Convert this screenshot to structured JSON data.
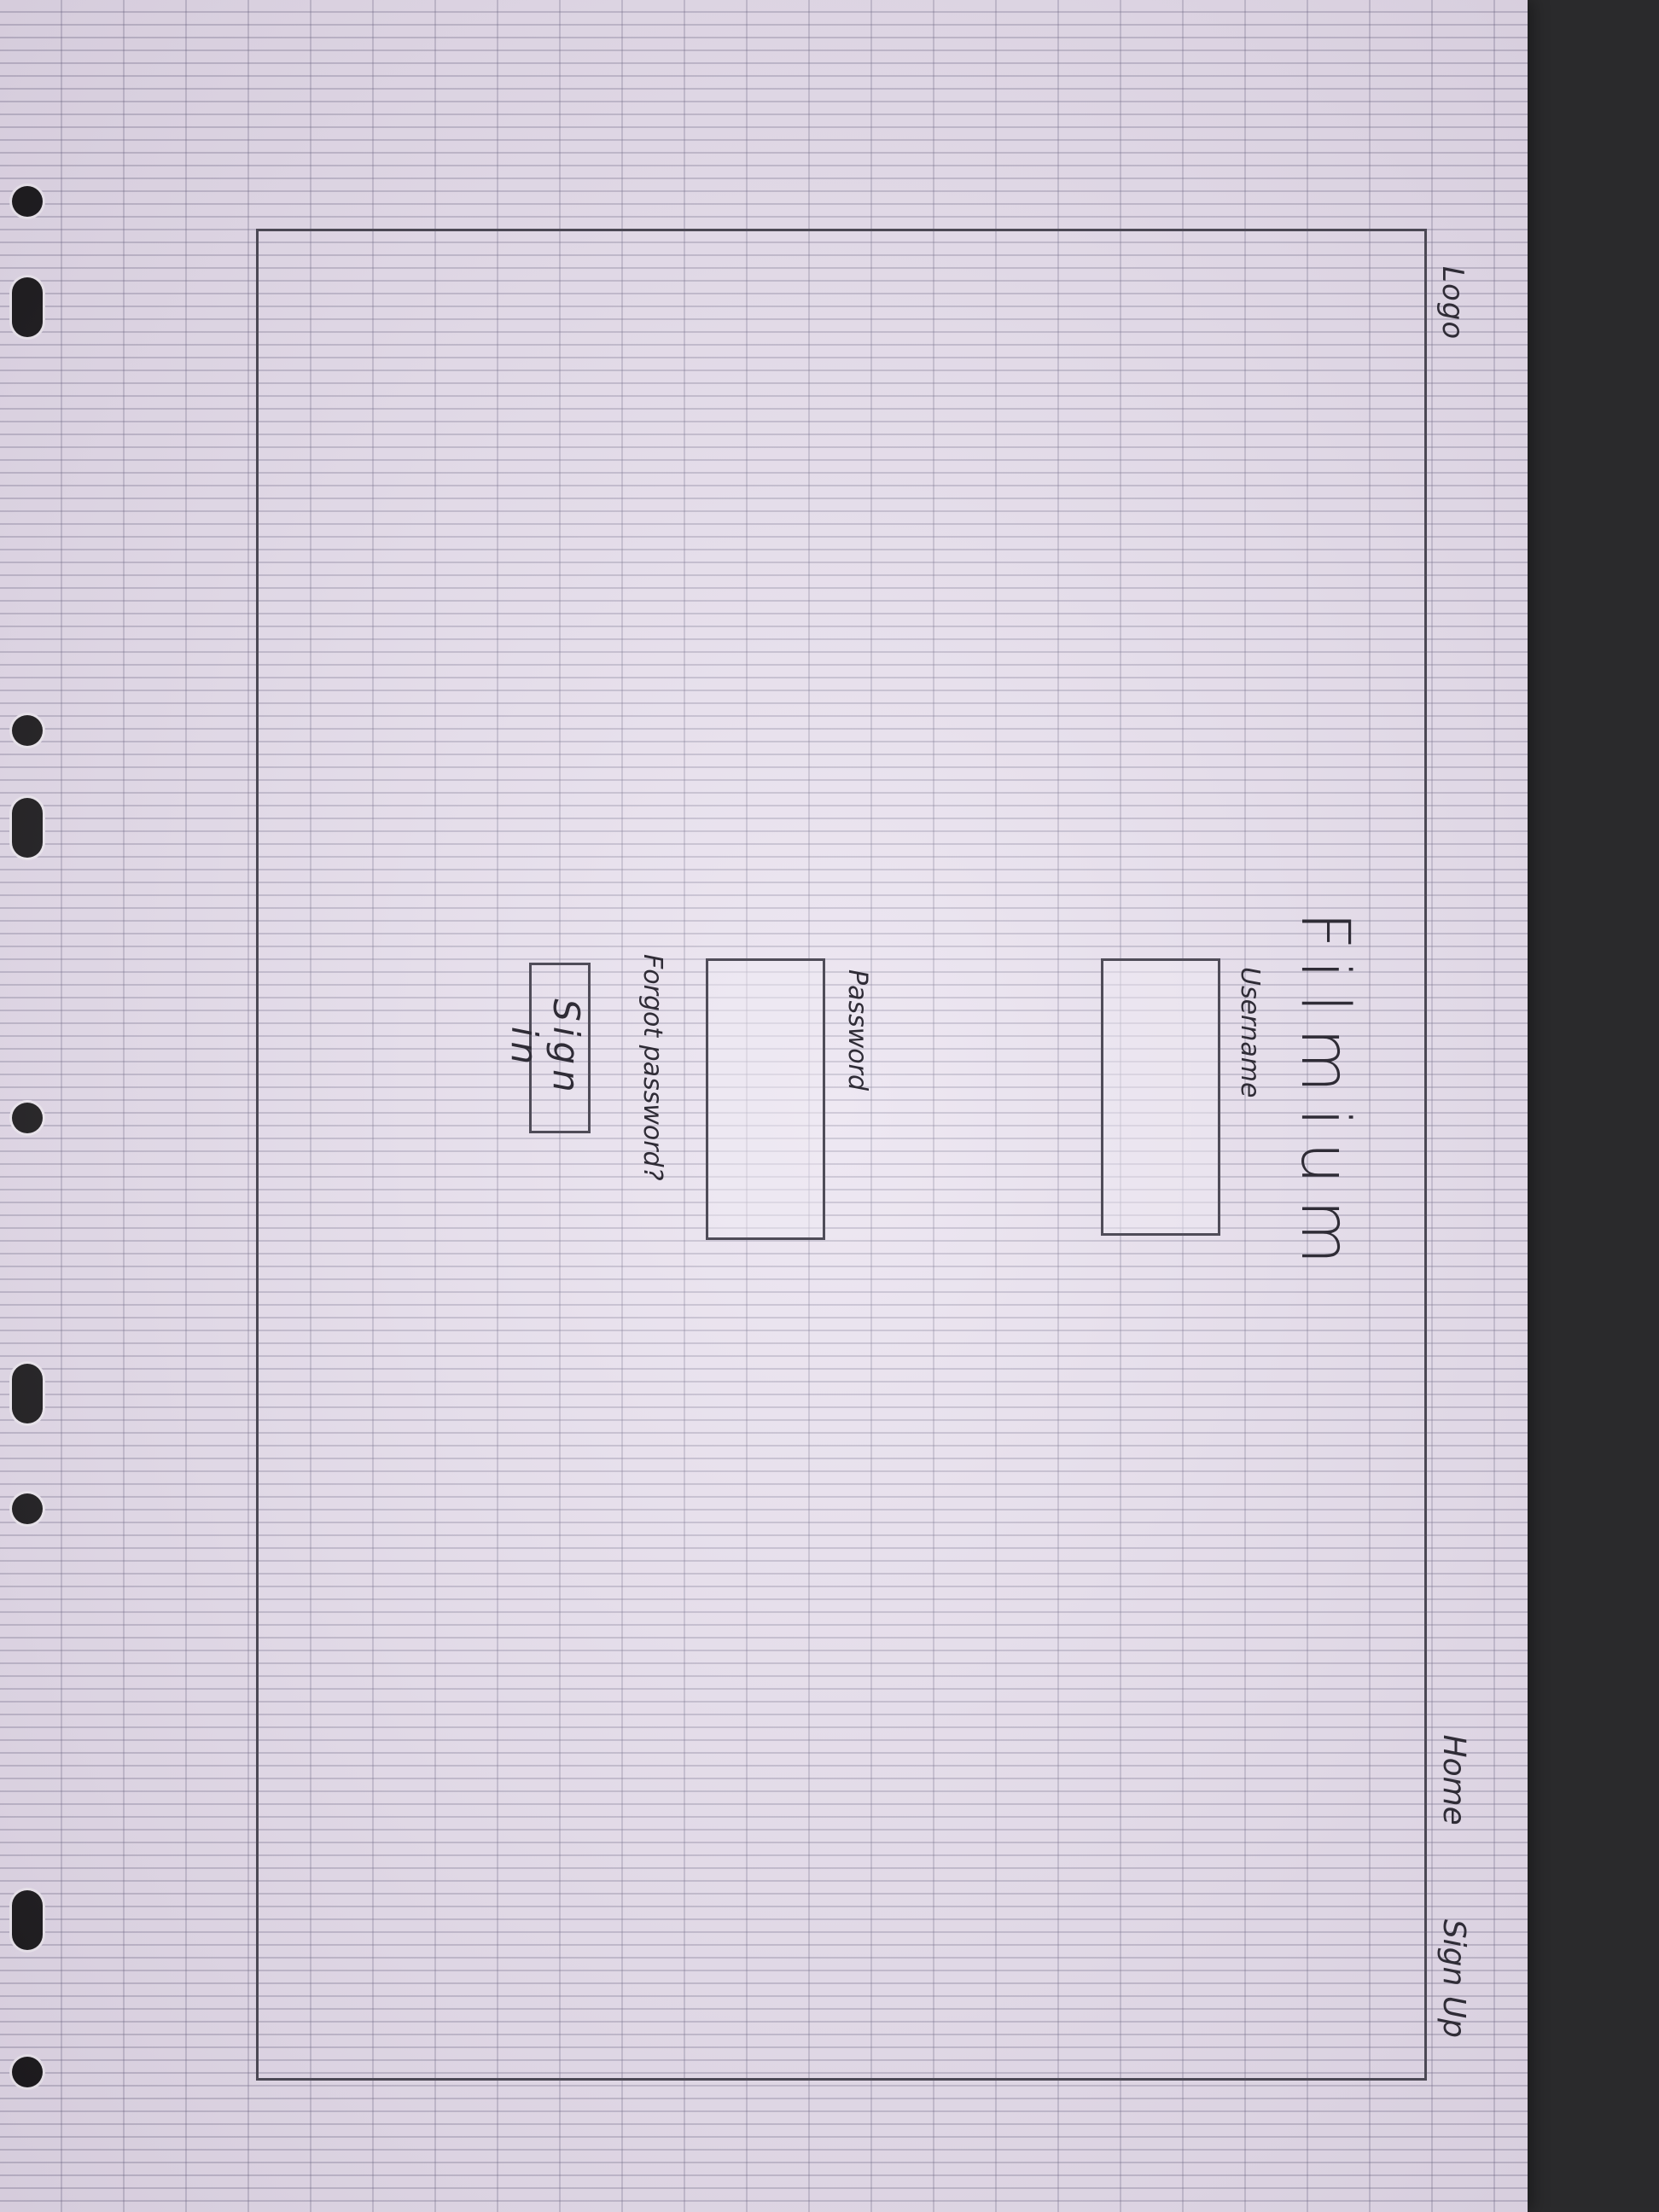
{
  "header": {
    "logo_text": "Logo",
    "nav": {
      "home_label": "Home",
      "signup_label": "Sign Up"
    }
  },
  "login": {
    "title": "Filmium",
    "username_label": "Username",
    "username_value": "",
    "password_label": "Password",
    "password_value": "",
    "forgot_password_label": "Forgot password?",
    "sign_in_label": "Sign in"
  },
  "colors": {
    "paper": "#e8e0ee",
    "ink": "#2f2c36",
    "background": "#2a2a2c"
  }
}
